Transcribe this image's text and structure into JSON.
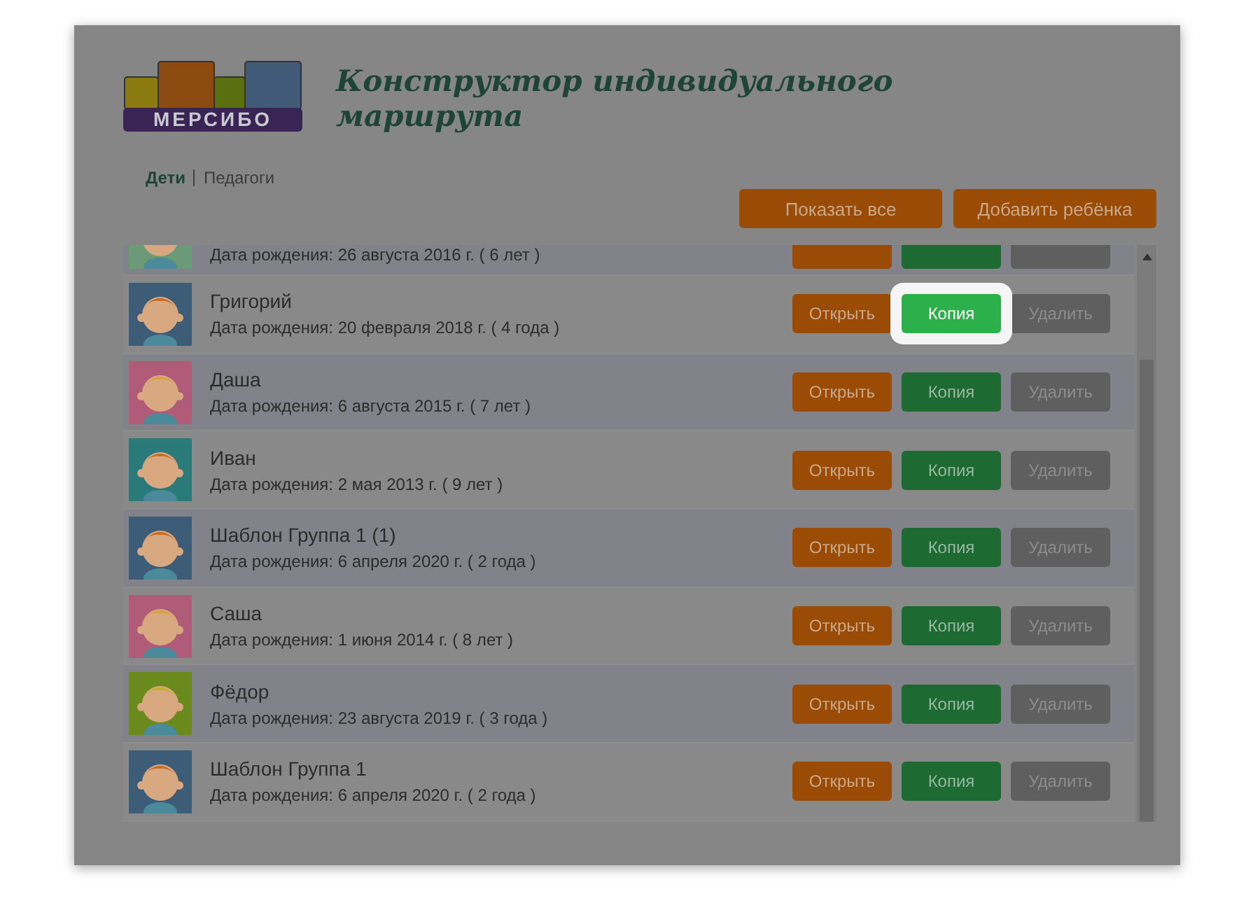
{
  "logo_text": "МЕРСИБО",
  "title": "Конструктор индивидуального маршрута",
  "tabs": [
    {
      "label": "Дети",
      "selected": true
    },
    {
      "label": "Педагоги",
      "selected": false
    }
  ],
  "toolbar_buttons": [
    "Показать все",
    "Добавить ребёнка"
  ],
  "children": [
    {
      "partial": true,
      "birth": "Дата рождения: 26 августа 2016 г. ( 6 лет )",
      "actions": [
        {
          "kind": "open",
          "highlighted": false
        },
        {
          "kind": "copy",
          "highlighted": false
        },
        {
          "kind": "delete",
          "highlighted": false
        }
      ]
    },
    {
      "partial": false,
      "name": "Григорий",
      "birth": "Дата рождения: 20 февраля 2018 г. ( 4 года )",
      "actions": [
        {
          "kind": "open",
          "label": "Открыть",
          "highlighted": false
        },
        {
          "kind": "copy",
          "label": "Копия",
          "highlighted": true
        },
        {
          "kind": "delete",
          "label": "Удалить",
          "highlighted": false
        }
      ]
    },
    {
      "partial": false,
      "name": "Даша",
      "birth": "Дата рождения: 6 августа 2015 г. ( 7 лет )",
      "actions": [
        {
          "kind": "open",
          "label": "Открыть",
          "highlighted": false
        },
        {
          "kind": "copy",
          "label": "Копия",
          "highlighted": false
        },
        {
          "kind": "delete",
          "label": "Удалить",
          "highlighted": false
        }
      ]
    },
    {
      "partial": false,
      "name": "Иван",
      "birth": "Дата рождения: 2 мая 2013 г. ( 9 лет )",
      "actions": [
        {
          "kind": "open",
          "label": "Открыть",
          "highlighted": false
        },
        {
          "kind": "copy",
          "label": "Копия",
          "highlighted": false
        },
        {
          "kind": "delete",
          "label": "Удалить",
          "highlighted": false
        }
      ]
    },
    {
      "partial": false,
      "name": "Шаблон Группа 1 (1)",
      "birth": "Дата рождения: 6 апреля 2020 г. ( 2 года )",
      "actions": [
        {
          "kind": "open",
          "label": "Открыть",
          "highlighted": false
        },
        {
          "kind": "copy",
          "label": "Копия",
          "highlighted": false
        },
        {
          "kind": "delete",
          "label": "Удалить",
          "highlighted": false
        }
      ]
    },
    {
      "partial": false,
      "name": "Саша",
      "birth": "Дата рождения: 1 июня 2014 г. ( 8 лет )",
      "actions": [
        {
          "kind": "open",
          "label": "Открыть",
          "highlighted": false
        },
        {
          "kind": "copy",
          "label": "Копия",
          "highlighted": false
        },
        {
          "kind": "delete",
          "label": "Удалить",
          "highlighted": false
        }
      ]
    },
    {
      "partial": false,
      "name": "Фёдор",
      "birth": "Дата рождения: 23 августа 2019 г. ( 3 года )",
      "actions": [
        {
          "kind": "open",
          "label": "Открыть",
          "highlighted": false
        },
        {
          "kind": "copy",
          "label": "Копия",
          "highlighted": false
        },
        {
          "kind": "delete",
          "label": "Удалить",
          "highlighted": false
        }
      ]
    },
    {
      "partial": false,
      "name": "Шаблон Группа 1",
      "birth": "Дата рождения: 6 апреля 2020 г. ( 2 года )",
      "actions": [
        {
          "kind": "open",
          "label": "Открыть",
          "highlighted": false
        },
        {
          "kind": "copy",
          "label": "Копия",
          "highlighted": false
        },
        {
          "kind": "delete",
          "label": "Удалить",
          "highlighted": false
        }
      ]
    }
  ]
}
